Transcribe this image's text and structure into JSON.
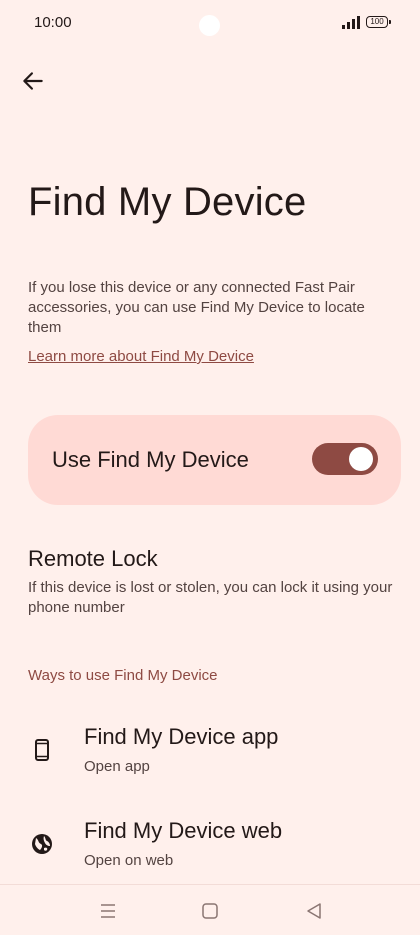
{
  "status": {
    "time": "10:00",
    "battery": "100"
  },
  "header": {
    "title": "Find My Device"
  },
  "description": "If you lose this device or any connected Fast Pair accessories, you can use Find My Device to locate them",
  "learn_more": "Learn more about Find My Device",
  "main_toggle": {
    "label": "Use Find My Device",
    "on": true
  },
  "remote_lock": {
    "title": "Remote Lock",
    "description": "If this device is lost or stolen, you can lock it using your phone number"
  },
  "section": {
    "title": "Ways to use Find My Device",
    "items": [
      {
        "title": "Find My Device app",
        "subtitle": "Open app",
        "icon": "phone-icon"
      },
      {
        "title": "Find My Device web",
        "subtitle": "Open on web",
        "icon": "globe-icon"
      }
    ]
  },
  "colors": {
    "background": "#fff0ec",
    "accent": "#8e4a43",
    "card": "#ffdad5"
  }
}
